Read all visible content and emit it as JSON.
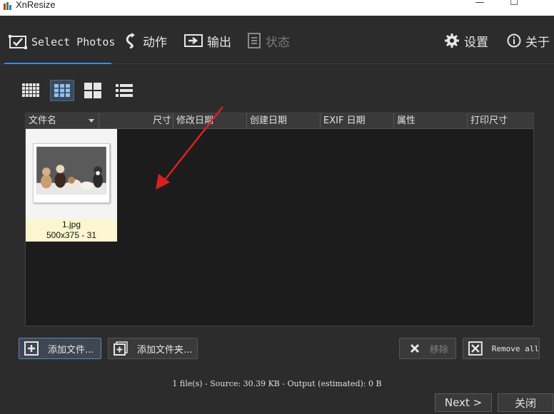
{
  "window": {
    "title": "XnResize",
    "minimize_glyph": "—",
    "maximize_glyph": "☐"
  },
  "toolbar": {
    "tabs": [
      {
        "label": "Select Photos",
        "icon": "select-photos-icon",
        "state": "active"
      },
      {
        "label": "动作",
        "icon": "action-icon",
        "state": "normal"
      },
      {
        "label": "输出",
        "icon": "output-icon",
        "state": "normal"
      },
      {
        "label": "状态",
        "icon": "status-icon",
        "state": "disabled"
      }
    ],
    "settings_label": "设置",
    "about_label": "关于"
  },
  "view_modes": [
    {
      "icon": "small-thumbnails-icon",
      "active": false
    },
    {
      "icon": "medium-thumbnails-icon",
      "active": true
    },
    {
      "icon": "large-thumbnails-icon",
      "active": false
    },
    {
      "icon": "details-list-icon",
      "active": false
    }
  ],
  "file_list": {
    "columns": [
      "文件名",
      "尺寸",
      "修改日期",
      "创建日期",
      "EXIF 日期",
      "属性",
      "打印尺寸"
    ],
    "items": [
      {
        "name": "1.jpg",
        "info": "500x375 - 31"
      }
    ]
  },
  "buttons": {
    "add_files": "添加文件...",
    "add_folder": "添加文件夹...",
    "remove": "移除",
    "remove_all": "Remove all",
    "next": "Next >",
    "close": "关闭"
  },
  "status": {
    "text": "1 file(s) - Source: 30.39 KB - Output (estimated): 0 B"
  },
  "colors": {
    "background": "#2c2c2c",
    "list_background": "#1c1c1c",
    "accent": "#3a8ee6",
    "annotation_arrow": "#d92020",
    "caption_background": "#fbf6cf"
  }
}
